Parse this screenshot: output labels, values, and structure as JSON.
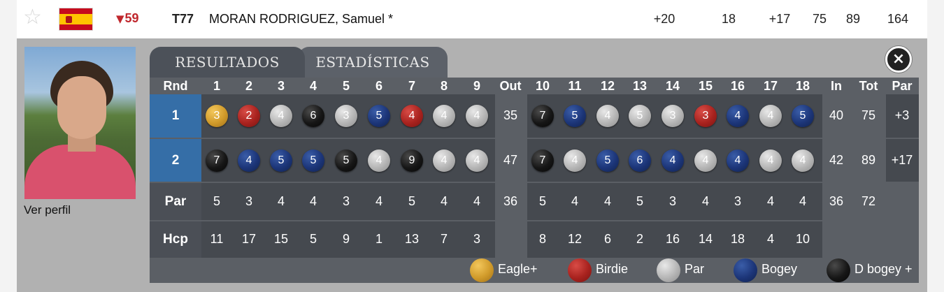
{
  "player_row": {
    "star_icon": "star-outline-icon",
    "flag": "spain-flag",
    "move_icon": "arrow-down-icon",
    "move": "59",
    "position": "T77",
    "name": "MORAN RODRIGUEZ, Samuel *",
    "to_par": "+20",
    "thru": "18",
    "today": "+17",
    "r1": "75",
    "r2": "89",
    "total": "164"
  },
  "profile": {
    "link": "Ver perfil"
  },
  "tabs": [
    {
      "label": "RESULTADOS"
    },
    {
      "label": "ESTADÍSTICAS"
    }
  ],
  "close_icon": "close-icon",
  "scorecard": {
    "headers": {
      "rnd": "Rnd",
      "front": [
        "1",
        "2",
        "3",
        "4",
        "5",
        "6",
        "7",
        "8",
        "9"
      ],
      "out": "Out",
      "back": [
        "10",
        "11",
        "12",
        "13",
        "14",
        "15",
        "16",
        "17",
        "18"
      ],
      "in": "In",
      "tot": "Tot",
      "par": "Par"
    },
    "rounds": [
      {
        "label": "1",
        "front": [
          {
            "v": "3",
            "t": "eagle"
          },
          {
            "v": "2",
            "t": "birdie"
          },
          {
            "v": "4",
            "t": "par"
          },
          {
            "v": "6",
            "t": "dbogey"
          },
          {
            "v": "3",
            "t": "par"
          },
          {
            "v": "5",
            "t": "bogey"
          },
          {
            "v": "4",
            "t": "birdie"
          },
          {
            "v": "4",
            "t": "par"
          },
          {
            "v": "4",
            "t": "par"
          }
        ],
        "out": "35",
        "back": [
          {
            "v": "7",
            "t": "dbogey"
          },
          {
            "v": "5",
            "t": "bogey"
          },
          {
            "v": "4",
            "t": "par"
          },
          {
            "v": "5",
            "t": "par"
          },
          {
            "v": "3",
            "t": "par"
          },
          {
            "v": "3",
            "t": "birdie"
          },
          {
            "v": "4",
            "t": "bogey"
          },
          {
            "v": "4",
            "t": "par"
          },
          {
            "v": "5",
            "t": "bogey"
          }
        ],
        "in": "40",
        "tot": "75",
        "par": "+3"
      },
      {
        "label": "2",
        "front": [
          {
            "v": "7",
            "t": "dbogey"
          },
          {
            "v": "4",
            "t": "bogey"
          },
          {
            "v": "5",
            "t": "bogey"
          },
          {
            "v": "5",
            "t": "bogey"
          },
          {
            "v": "5",
            "t": "dbogey"
          },
          {
            "v": "4",
            "t": "par"
          },
          {
            "v": "9",
            "t": "dbogey"
          },
          {
            "v": "4",
            "t": "par"
          },
          {
            "v": "4",
            "t": "par"
          }
        ],
        "out": "47",
        "back": [
          {
            "v": "7",
            "t": "dbogey"
          },
          {
            "v": "4",
            "t": "par"
          },
          {
            "v": "5",
            "t": "bogey"
          },
          {
            "v": "6",
            "t": "bogey"
          },
          {
            "v": "4",
            "t": "bogey"
          },
          {
            "v": "4",
            "t": "par"
          },
          {
            "v": "4",
            "t": "bogey"
          },
          {
            "v": "4",
            "t": "par"
          },
          {
            "v": "4",
            "t": "par"
          }
        ],
        "in": "42",
        "tot": "89",
        "par": "+17"
      }
    ],
    "par_row": {
      "label": "Par",
      "front": [
        "5",
        "3",
        "4",
        "4",
        "3",
        "4",
        "5",
        "4",
        "4"
      ],
      "out": "36",
      "back": [
        "5",
        "4",
        "4",
        "5",
        "3",
        "4",
        "3",
        "4",
        "4"
      ],
      "in": "36",
      "tot": "72"
    },
    "hcp_row": {
      "label": "Hcp",
      "front": [
        "11",
        "17",
        "15",
        "5",
        "9",
        "1",
        "13",
        "7",
        "3"
      ],
      "back": [
        "8",
        "12",
        "6",
        "2",
        "16",
        "14",
        "18",
        "4",
        "10"
      ]
    },
    "legend": [
      {
        "label": "Eagle+",
        "t": "eagle"
      },
      {
        "label": "Birdie",
        "t": "birdie"
      },
      {
        "label": "Par",
        "t": "par"
      },
      {
        "label": "Bogey",
        "t": "bogey"
      },
      {
        "label": "D bogey +",
        "t": "dbogey"
      }
    ]
  }
}
